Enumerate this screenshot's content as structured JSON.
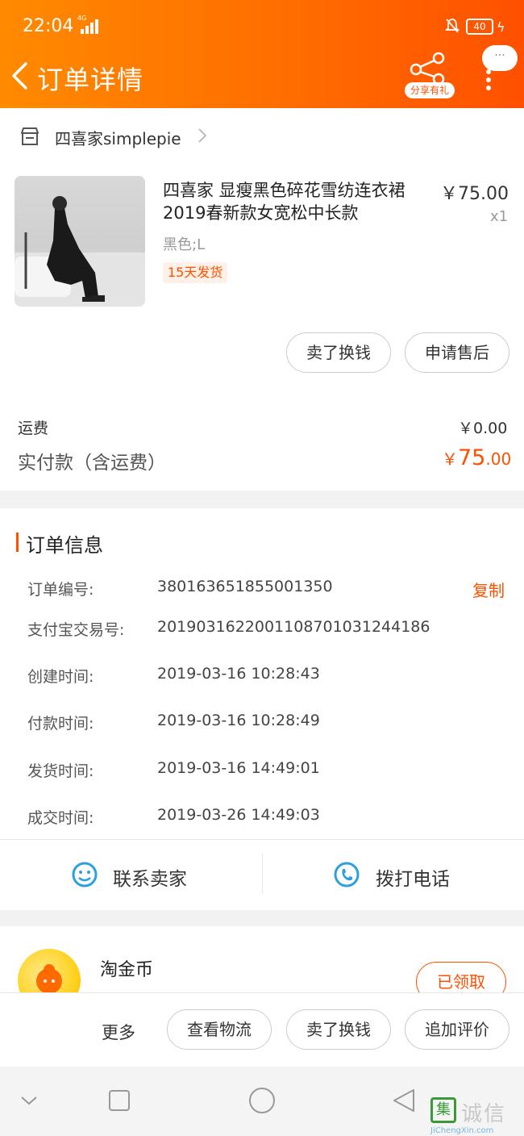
{
  "status": {
    "time": "22:04",
    "network": "4G",
    "battery": "40"
  },
  "header": {
    "title": "订单详情",
    "share_label": "分享有礼",
    "message_dots": "···"
  },
  "shop": {
    "name": "四喜家simplepie"
  },
  "product": {
    "title": "四喜家 显瘦黑色碎花雪纺连衣裙2019春新款女宽松中长款",
    "price": "￥75.00",
    "qty": "x1",
    "sku": "黑色;L",
    "ship_tag": "15天发货",
    "actions": [
      "卖了换钱",
      "申请售后"
    ]
  },
  "fees": {
    "shipping_label": "运费",
    "shipping_value": "￥0.00",
    "total_label": "实付款（含运费）",
    "total_symbol": "￥",
    "total_int": "75",
    "total_dec": ".00"
  },
  "order_info": {
    "title": "订单信息",
    "copy_label": "复制",
    "rows": [
      {
        "label": "订单编号:",
        "value": "380163651855001350"
      },
      {
        "label": "支付宝交易号:",
        "value": "2019031622001108701031244186"
      },
      {
        "label": "创建时间:",
        "value": "2019-03-16 10:28:43"
      },
      {
        "label": "付款时间:",
        "value": "2019-03-16 10:28:49"
      },
      {
        "label": "发货时间:",
        "value": "2019-03-16 14:49:01"
      },
      {
        "label": "成交时间:",
        "value": "2019-03-26 14:49:03"
      }
    ]
  },
  "contact": {
    "seller_label": "联系卖家",
    "phone_label": "拨打电话"
  },
  "coins": {
    "title": "淘金币",
    "button": "已领取"
  },
  "bottom_bar": {
    "more_label": "更多",
    "buttons": [
      "查看物流",
      "卖了换钱",
      "追加评价"
    ]
  },
  "watermark": {
    "logo_char": "集",
    "text": "诚信",
    "url": "JiChengXin.com"
  },
  "colors": {
    "accent": "#ff5000",
    "header_start": "#ff8a00",
    "contact_icon": "#2ba0e0"
  }
}
